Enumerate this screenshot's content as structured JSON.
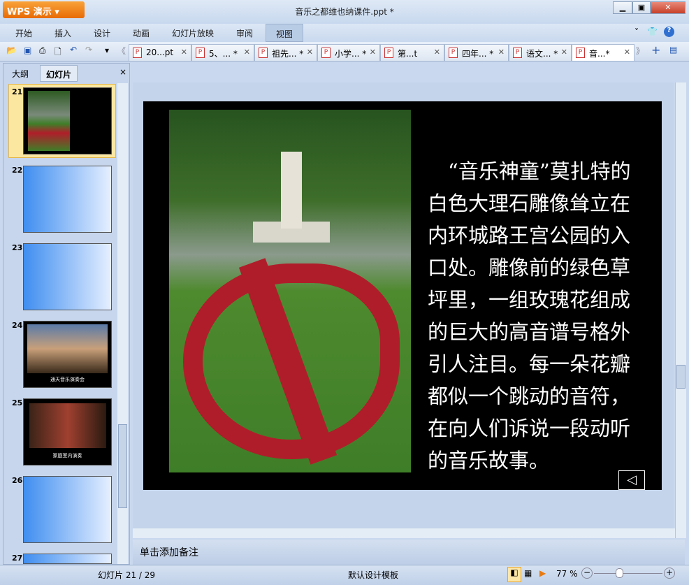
{
  "app": {
    "brand": "WPS 演示",
    "title": "音乐之都维也纳课件.ppt *"
  },
  "menu": [
    "开始",
    "插入",
    "设计",
    "动画",
    "幻灯片放映",
    "审阅",
    "视图"
  ],
  "doc_tabs": [
    {
      "label": "20...pt"
    },
    {
      "label": "5、... *"
    },
    {
      "label": "祖先... *"
    },
    {
      "label": "小学... *"
    },
    {
      "label": "第...t"
    },
    {
      "label": "四年... *"
    },
    {
      "label": "语文... *"
    },
    {
      "label": "音...*",
      "active": true
    }
  ],
  "sidebar": {
    "tabs": [
      "大纲",
      "幻灯片"
    ],
    "close": "×",
    "slides": [
      {
        "n": "21",
        "selected": true
      },
      {
        "n": "22"
      },
      {
        "n": "23"
      },
      {
        "n": "24",
        "caption": "通天音乐演奏会"
      },
      {
        "n": "25",
        "caption": "家庭室内演奏"
      },
      {
        "n": "26"
      },
      {
        "n": "27"
      }
    ]
  },
  "slide": {
    "text": "　“音乐神童”莫扎特的白色大理石雕像耸立在内环城路王宫公园的入口处。雕像前的绿色草坪里，一组玫瑰花组成的巨大的高音谱号格外引人注目。每一朵花瓣都似一个跳动的音符，在向人们诉说一段动听的音乐故事。",
    "back_button": "◁"
  },
  "notes": {
    "placeholder": "单击添加备注"
  },
  "status": {
    "slide_info": "幻灯片 21 / 29",
    "template": "默认设计模板",
    "zoom": "77 %",
    "zoom_percent": 77
  },
  "colors": {
    "accent": "#e86a05",
    "slide_bg": "#000000"
  }
}
